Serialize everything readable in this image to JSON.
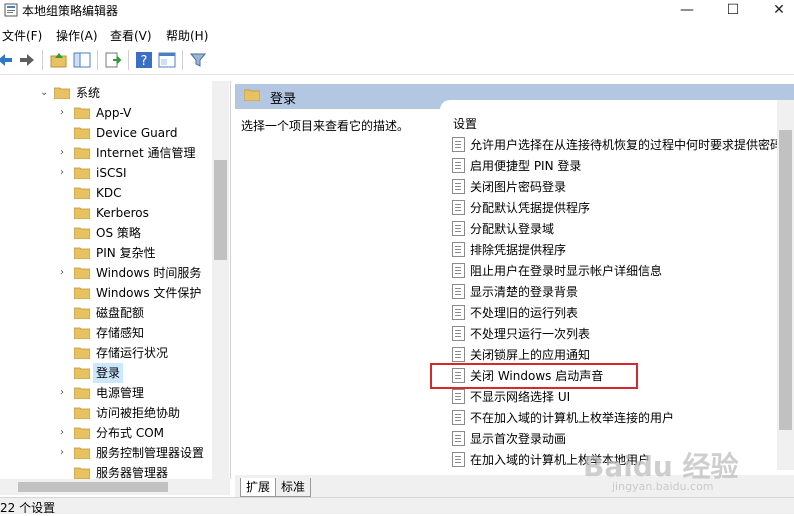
{
  "window": {
    "title": "本地组策略编辑器",
    "minimize": "—",
    "maximize": "☐",
    "close": "✕"
  },
  "menu": [
    "文件(F)",
    "操作(A)",
    "查看(V)",
    "帮助(H)"
  ],
  "toolbar": [
    "back-icon",
    "forward-icon",
    "up-folder-icon",
    "show-hide-tree-icon",
    "export-list-icon",
    "help-icon",
    "properties-icon",
    "filter-icon"
  ],
  "tree": {
    "items": [
      {
        "label": "系统",
        "expanded": true
      },
      {
        "label": "App-V",
        "expandable": true
      },
      {
        "label": "Device Guard",
        "expandable": false
      },
      {
        "label": "Internet 通信管理",
        "expandable": true
      },
      {
        "label": "iSCSI",
        "expandable": true
      },
      {
        "label": "KDC",
        "expandable": false
      },
      {
        "label": "Kerberos",
        "expandable": false
      },
      {
        "label": "OS 策略",
        "expandable": false
      },
      {
        "label": "PIN 复杂性",
        "expandable": false
      },
      {
        "label": "Windows 时间服务",
        "expandable": true
      },
      {
        "label": "Windows 文件保护",
        "expandable": false
      },
      {
        "label": "磁盘配额",
        "expandable": false
      },
      {
        "label": "存储感知",
        "expandable": false
      },
      {
        "label": "存储运行状况",
        "expandable": false
      },
      {
        "label": "登录",
        "expandable": false,
        "selected": true
      },
      {
        "label": "电源管理",
        "expandable": true
      },
      {
        "label": "访问被拒绝协助",
        "expandable": false
      },
      {
        "label": "分布式 COM",
        "expandable": true
      },
      {
        "label": "服务控制管理器设置",
        "expandable": true
      },
      {
        "label": "服务器管理器",
        "expandable": false
      }
    ]
  },
  "right": {
    "header_title": "登录",
    "description": "选择一个项目来查看它的描述。",
    "column_header": "设置",
    "settings": [
      "允许用户选择在从连接待机恢复的过程中何时要求提供密码",
      "启用便捷型 PIN 登录",
      "关闭图片密码登录",
      "分配默认凭据提供程序",
      "分配默认登录域",
      "排除凭据提供程序",
      "阻止用户在登录时显示帐户详细信息",
      "显示清楚的登录背景",
      "不处理旧的运行列表",
      "不处理只运行一次列表",
      "关闭锁屏上的应用通知",
      "关闭 Windows 启动声音",
      "不显示网络选择 UI",
      "不在加入域的计算机上枚举连接的用户",
      "显示首次登录动画",
      "在加入域的计算机上枚举本地用户"
    ],
    "highlighted": "关闭 Windows 启动声音"
  },
  "tabs": [
    "扩展",
    "标准"
  ],
  "status": "22 个设置",
  "watermark": {
    "main": "Baidu 经验",
    "sub": "jingyan.baidu.com"
  },
  "colors": {
    "header_bg": "#b3c7e3",
    "highlight_border": "#d9272e",
    "selected_bg": "#cce8ff",
    "folder": "#e8c163"
  }
}
